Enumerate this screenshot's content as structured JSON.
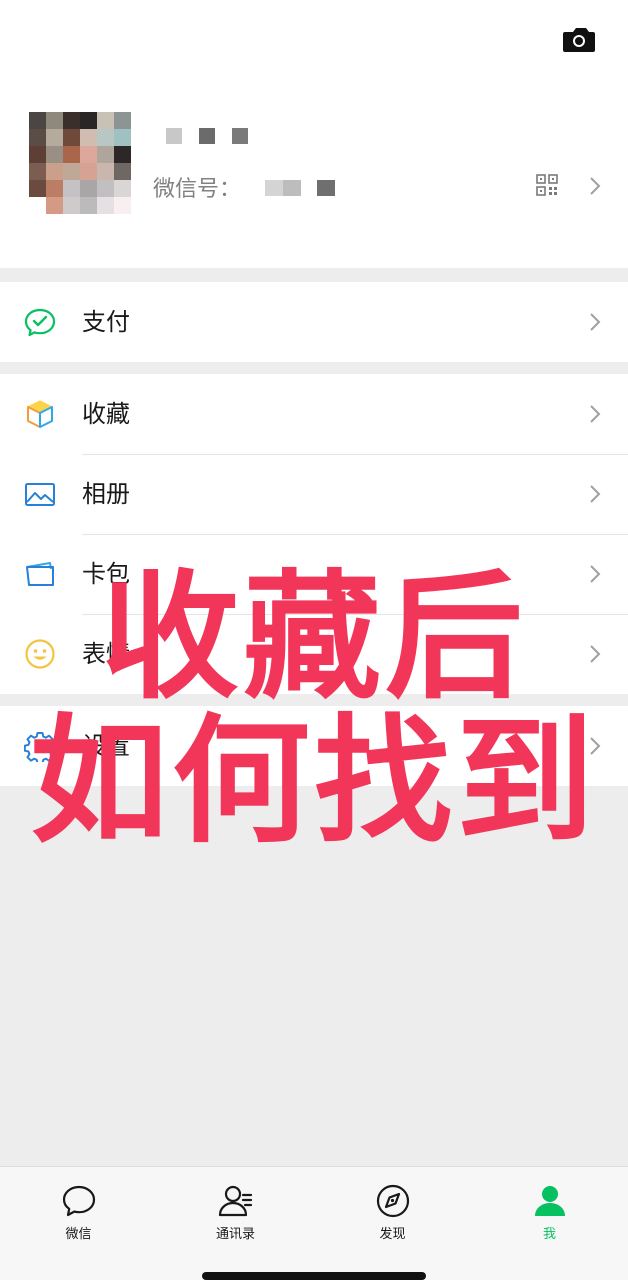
{
  "profile": {
    "wxid_label": "微信号：",
    "camera_icon": "camera-icon",
    "qr_icon": "qr-code-icon"
  },
  "menu": {
    "pay": {
      "label": "支付",
      "icon": "wechat-pay-icon",
      "color": "#07c160"
    },
    "favorites": {
      "label": "收藏",
      "icon": "favorites-cube-icon"
    },
    "album": {
      "label": "相册",
      "icon": "album-picture-icon",
      "color": "#2782d7"
    },
    "cards": {
      "label": "卡包",
      "icon": "card-wallet-icon",
      "color": "#2782d7"
    },
    "stickers": {
      "label": "表情",
      "icon": "sticker-smile-icon",
      "color": "#f5c342"
    },
    "settings": {
      "label": "设置",
      "icon": "gear-icon",
      "color": "#2782d7"
    }
  },
  "overlay": {
    "line1": "收藏后",
    "line2": "如何找到",
    "color": "#f2365a"
  },
  "tabs": [
    {
      "label": "微信",
      "icon": "chat-bubble-icon"
    },
    {
      "label": "通讯录",
      "icon": "contacts-icon"
    },
    {
      "label": "发现",
      "icon": "compass-icon"
    },
    {
      "label": "我",
      "icon": "person-icon",
      "active": true,
      "color": "#07c160"
    }
  ]
}
